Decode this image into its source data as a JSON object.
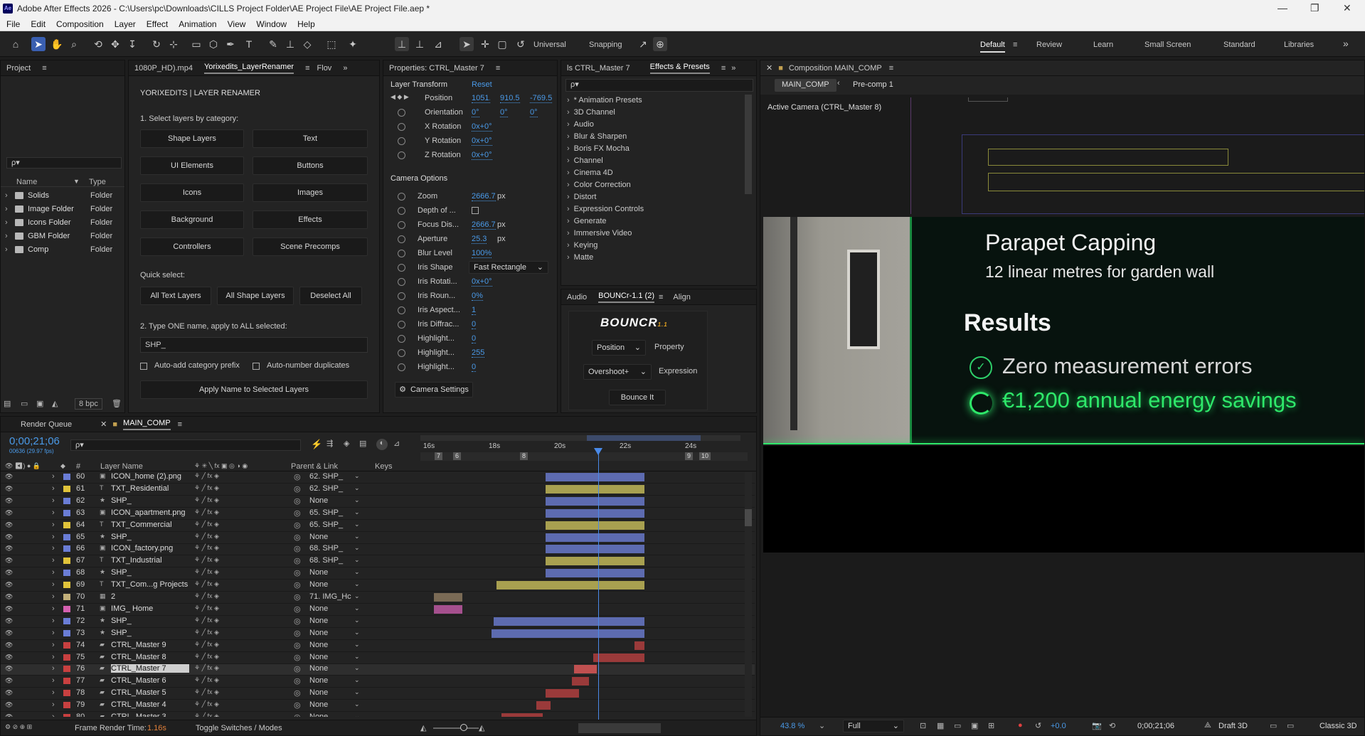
{
  "app": {
    "title": "Adobe After Effects 2026 - C:\\Users\\pc\\Downloads\\CILLS Project Folder\\AE Project File\\AE Project File.aep *",
    "logo": "Ae",
    "window_controls": [
      "—",
      "❐",
      "✕"
    ]
  },
  "menu": [
    "File",
    "Edit",
    "Composition",
    "Layer",
    "Effect",
    "Animation",
    "View",
    "Window",
    "Help"
  ],
  "toolbar": {
    "axis_mode": "Universal",
    "snapping": "Snapping",
    "workspaces": [
      "Default",
      "Review",
      "Learn",
      "Small Screen",
      "Standard",
      "Libraries"
    ],
    "more": "»"
  },
  "project": {
    "tab": "Project",
    "search_placeholder": "ρ▾",
    "col_name": "Name",
    "col_type": "Type",
    "items": [
      {
        "name": "Solids",
        "type": "Folder"
      },
      {
        "name": "Image Folder",
        "type": "Folder"
      },
      {
        "name": "Icons Folder",
        "type": "Folder"
      },
      {
        "name": "GBM Folder",
        "type": "Folder"
      },
      {
        "name": "Comp",
        "type": "Folder"
      }
    ],
    "bpc": "8 bpc"
  },
  "renamer": {
    "tab_file": "1080P_HD).mp4",
    "tab_active": "Yorixedits_LayerRenamer",
    "tab_more": "Flov",
    "header": "YORIXEDITS  |  LAYER RENAMER",
    "step1": "1. Select layers by category:",
    "categories": [
      "Shape Layers",
      "Text",
      "UI Elements",
      "Buttons",
      "Icons",
      "Images",
      "Background",
      "Effects",
      "Controllers",
      "Scene Precomps"
    ],
    "quick_select": "Quick select:",
    "quick": [
      "All Text Layers",
      "All Shape Layers",
      "Deselect All"
    ],
    "step2": "2. Type ONE name, apply to ALL selected:",
    "name_value": "SHP_",
    "opt1": "Auto-add category prefix",
    "opt2": "Auto-number duplicates",
    "apply": "Apply Name to Selected Layers"
  },
  "properties": {
    "tab": "Properties: CTRL_Master 7",
    "section1": "Layer Transform",
    "reset": "Reset",
    "position_label": "Position",
    "position": [
      "1051.:",
      "910.5",
      "-769.5"
    ],
    "orientation_label": "Orientation",
    "orientation": [
      "0°",
      "0°",
      "0°"
    ],
    "rotations": [
      {
        "name": "X Rotation",
        "value": "0x+0°"
      },
      {
        "name": "Y Rotation",
        "value": "0x+0°"
      },
      {
        "name": "Z Rotation",
        "value": "0x+0°"
      }
    ],
    "section2": "Camera Options",
    "camera": [
      {
        "name": "Zoom",
        "value": "2666.7",
        "unit": "px"
      },
      {
        "name": "Depth of ...",
        "value": "",
        "unit": "",
        "checkbox": true
      },
      {
        "name": "Focus Dis...",
        "value": "2666.7",
        "unit": "px"
      },
      {
        "name": "Aperture",
        "value": "25.3",
        "unit": "px"
      },
      {
        "name": "Blur Level",
        "value": "100%",
        "unit": ""
      },
      {
        "name": "Iris Shape",
        "value": "Fast Rectangle",
        "unit": "",
        "dropdown": true
      },
      {
        "name": "Iris Rotati...",
        "value": "0x+0°",
        "unit": ""
      },
      {
        "name": "Iris Roun...",
        "value": "0%",
        "unit": ""
      },
      {
        "name": "Iris Aspect...",
        "value": "1",
        "unit": ""
      },
      {
        "name": "Iris Diffrac...",
        "value": "0",
        "unit": ""
      },
      {
        "name": "Highlight...",
        "value": "0",
        "unit": ""
      },
      {
        "name": "Highlight...",
        "value": "255",
        "unit": ""
      },
      {
        "name": "Highlight...",
        "value": "0",
        "unit": ""
      }
    ],
    "camera_settings": "Camera Settings"
  },
  "effects": {
    "tab_left": "ls CTRL_Master 7",
    "tab": "Effects & Presets",
    "search_placeholder": "ρ▾",
    "items": [
      "* Animation Presets",
      "3D Channel",
      "Audio",
      "Blur & Sharpen",
      "Boris FX Mocha",
      "Channel",
      "Cinema 4D",
      "Color Correction",
      "Distort",
      "Expression Controls",
      "Generate",
      "Immersive Video",
      "Keying",
      "Matte"
    ]
  },
  "bouncr": {
    "tabs": [
      "Audio",
      "BOUNCr-1.1 (2)",
      "Align"
    ],
    "logo": "BOUNCR",
    "version": "1.1",
    "property_value": "Position",
    "property_label": "Property",
    "expression_value": "Overshoot+",
    "expression_label": "Expression",
    "button": "Bounce It"
  },
  "composition": {
    "tab": "Composition  MAIN_COMP",
    "crumbs": [
      "MAIN_COMP",
      "Pre-comp 1"
    ],
    "camera_label": "Active Camera (CTRL_Master 8)",
    "slide_title": "Parapet Capping",
    "slide_subtitle": "12 linear metres for garden wall",
    "results_title": "Results",
    "result1": "Zero measurement errors",
    "result2": "€1,200 annual energy savings",
    "zoom": "43.8 %",
    "quality": "Full",
    "exposure": "+0.0",
    "timecode": "0;00;21;06",
    "renderer": "Draft 3D",
    "mode": "Classic 3D",
    "accent": "#2ee86a"
  },
  "timeline": {
    "tabs": [
      "Render Queue",
      "MAIN_COMP"
    ],
    "timecode": "0;00;21;06",
    "timecode_sub": "00636 (29.97 fps)",
    "search_placeholder": "ρ▾",
    "col_layer": "Layer Name",
    "col_parent": "Parent & Link",
    "col_keys": "Keys",
    "ticks": [
      "16s",
      "18s",
      "20s",
      "22s",
      "24s"
    ],
    "markers": [
      "7",
      "6",
      "8",
      "9",
      "10"
    ],
    "footer_render": "Frame Render Time:",
    "footer_time": "1.16s",
    "footer_toggle": "Toggle Switches / Modes",
    "layers": [
      {
        "num": "60",
        "type": "img",
        "name": "ICON_home (2).png",
        "parent": "62. SHP_",
        "color": "#6a7dd6",
        "bar_start": 0.395,
        "bar_end": 0.695,
        "bar_color": "#5d6bb0"
      },
      {
        "num": "61",
        "type": "T",
        "name": "TXT_Residential",
        "parent": "62. SHP_",
        "color": "#e0c33a",
        "bar_start": 0.395,
        "bar_end": 0.695,
        "bar_color": "#a8a050"
      },
      {
        "num": "62",
        "type": "★",
        "name": "SHP_",
        "parent": "None",
        "color": "#6a7dd6",
        "bar_start": 0.395,
        "bar_end": 0.695,
        "bar_color": "#5d6bb0"
      },
      {
        "num": "63",
        "type": "img",
        "name": "ICON_apartment.png",
        "parent": "65. SHP_",
        "color": "#6a7dd6",
        "bar_start": 0.395,
        "bar_end": 0.695,
        "bar_color": "#5d6bb0"
      },
      {
        "num": "64",
        "type": "T",
        "name": "TXT_Commercial",
        "parent": "65. SHP_",
        "color": "#e0c33a",
        "bar_start": 0.395,
        "bar_end": 0.695,
        "bar_color": "#a8a050"
      },
      {
        "num": "65",
        "type": "★",
        "name": "SHP_",
        "parent": "None",
        "color": "#6a7dd6",
        "bar_start": 0.395,
        "bar_end": 0.695,
        "bar_color": "#5d6bb0"
      },
      {
        "num": "66",
        "type": "img",
        "name": "ICON_factory.png",
        "parent": "68. SHP_",
        "color": "#6a7dd6",
        "bar_start": 0.395,
        "bar_end": 0.695,
        "bar_color": "#5d6bb0"
      },
      {
        "num": "67",
        "type": "T",
        "name": "TXT_Industrial",
        "parent": "68. SHP_",
        "color": "#e0c33a",
        "bar_start": 0.395,
        "bar_end": 0.695,
        "bar_color": "#a8a050"
      },
      {
        "num": "68",
        "type": "★",
        "name": "SHP_",
        "parent": "None",
        "color": "#6a7dd6",
        "bar_start": 0.395,
        "bar_end": 0.695,
        "bar_color": "#5d6bb0"
      },
      {
        "num": "69",
        "type": "T",
        "name": "TXT_Com...g Projects",
        "parent": "None",
        "color": "#e0c33a",
        "bar_start": 0.245,
        "bar_end": 0.695,
        "bar_color": "#a8a050"
      },
      {
        "num": "70",
        "type": "comp",
        "name": "2",
        "parent": "71. IMG_Hc",
        "color": "#c2b07a",
        "bar_start": 0.055,
        "bar_end": 0.14,
        "bar_color": "#7a6a55"
      },
      {
        "num": "71",
        "type": "img",
        "name": "IMG_ Home",
        "parent": "None",
        "color": "#d560b0",
        "bar_start": 0.055,
        "bar_end": 0.14,
        "bar_color": "#a5508e"
      },
      {
        "num": "72",
        "type": "★",
        "name": "SHP_",
        "parent": "None",
        "color": "#6a7dd6",
        "bar_start": 0.235,
        "bar_end": 0.695,
        "bar_color": "#5d6bb0"
      },
      {
        "num": "73",
        "type": "★",
        "name": "SHP_",
        "parent": "None",
        "color": "#6a7dd6",
        "bar_start": 0.23,
        "bar_end": 0.695,
        "bar_color": "#5d6bb0"
      },
      {
        "num": "74",
        "type": "cam",
        "name": "CTRL_Master 9",
        "parent": "None",
        "color": "#c84040",
        "bar_start": 0.665,
        "bar_end": 0.695,
        "bar_color": "#9a3a3a"
      },
      {
        "num": "75",
        "type": "cam",
        "name": "CTRL_Master 8",
        "parent": "None",
        "color": "#c84040",
        "bar_start": 0.54,
        "bar_end": 0.695,
        "bar_color": "#9a3a3a"
      },
      {
        "num": "76",
        "type": "cam",
        "name": "CTRL_Master 7",
        "parent": "None",
        "color": "#c84040",
        "bar_start": 0.48,
        "bar_end": 0.55,
        "bar_color": "#c05050",
        "selected": true
      },
      {
        "num": "77",
        "type": "cam",
        "name": "CTRL_Master 6",
        "parent": "None",
        "color": "#c84040",
        "bar_start": 0.475,
        "bar_end": 0.525,
        "bar_color": "#9a3a3a"
      },
      {
        "num": "78",
        "type": "cam",
        "name": "CTRL_Master 5",
        "parent": "None",
        "color": "#c84040",
        "bar_start": 0.395,
        "bar_end": 0.495,
        "bar_color": "#9a3a3a"
      },
      {
        "num": "79",
        "type": "cam",
        "name": "CTRL_Master 4",
        "parent": "None",
        "color": "#c84040",
        "bar_start": 0.365,
        "bar_end": 0.41,
        "bar_color": "#9a3a3a"
      },
      {
        "num": "80",
        "type": "cam",
        "name": "CTRL_Master 3",
        "parent": "None",
        "color": "#c84040",
        "bar_start": 0.26,
        "bar_end": 0.385,
        "bar_color": "#9a3a3a"
      }
    ]
  }
}
